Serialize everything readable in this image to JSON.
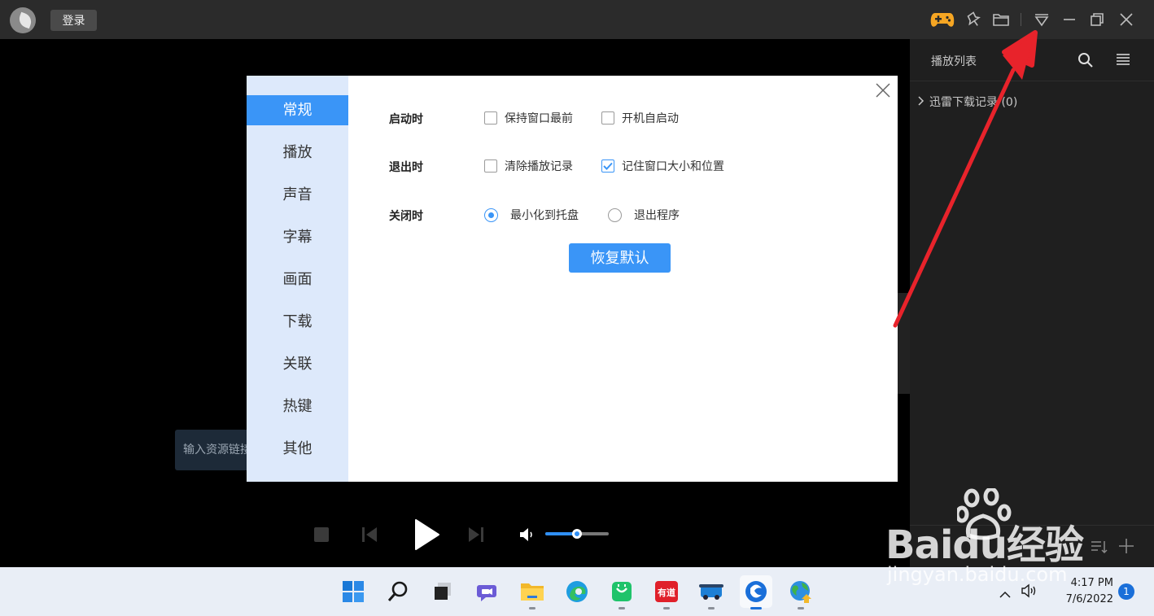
{
  "titlebar": {
    "login_label": "登录",
    "icons": [
      "game-controller-icon",
      "pin-icon",
      "folder-icon",
      "menu-dropdown-icon",
      "minimize-icon",
      "restore-icon",
      "close-icon"
    ]
  },
  "player": {
    "url_hint": "输入资源链接",
    "volume_fraction": 0.5
  },
  "playlist": {
    "title": "播放列表",
    "item": "迅雷下载记录 (0)"
  },
  "dialog": {
    "nav": [
      "常规",
      "播放",
      "声音",
      "字幕",
      "画面",
      "下载",
      "关联",
      "热键",
      "其他"
    ],
    "active_nav": "常规",
    "rows": {
      "startup": {
        "label": "启动时",
        "opt1": "保持窗口最前",
        "opt2": "开机自启动"
      },
      "exit": {
        "label": "退出时",
        "opt1": "清除播放记录",
        "opt2": "记住窗口大小和位置"
      },
      "close": {
        "label": "关闭时",
        "opt1": "最小化到托盘",
        "opt2": "退出程序"
      }
    },
    "checked": {
      "keep_on_top": false,
      "autostart": false,
      "clear_history": false,
      "remember_window": true
    },
    "close_action": "最小化到托盘",
    "restore_label": "恢复默认"
  },
  "taskbar": {
    "time": "4:17 PM",
    "date": "7/6/2022",
    "notification_count": "1",
    "youdao_label": "有道"
  },
  "watermark": {
    "brand": "Baidu经验",
    "url": "jingyan.baidu.com"
  },
  "colors": {
    "accent": "#3a95f7",
    "arrow": "#e8232b",
    "nav_bg": "#dde9fb"
  }
}
